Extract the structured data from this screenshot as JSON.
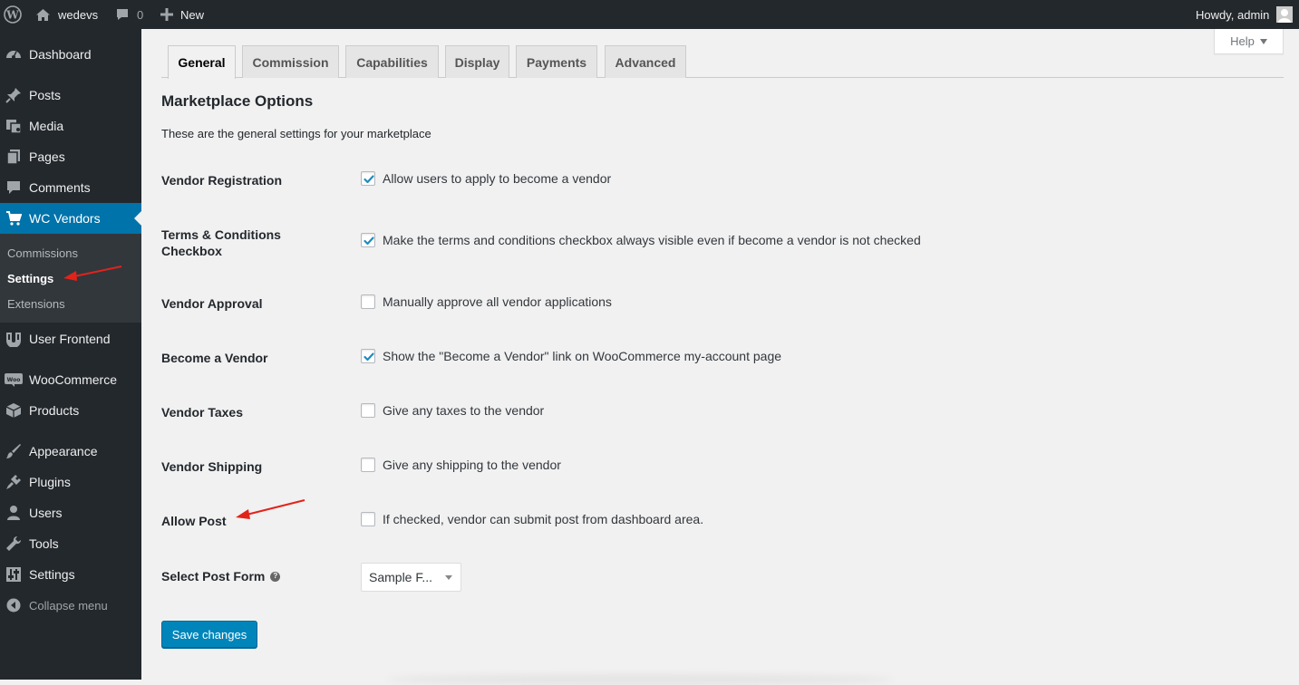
{
  "adminbar": {
    "site_name": "wedevs",
    "comments_count": "0",
    "new_label": "New",
    "greeting": "Howdy, admin"
  },
  "sidebar": {
    "items": [
      {
        "label": "Dashboard",
        "icon": "dashboard-icon"
      },
      {
        "label": "Posts",
        "icon": "pin-icon"
      },
      {
        "label": "Media",
        "icon": "media-icon"
      },
      {
        "label": "Pages",
        "icon": "pages-icon"
      },
      {
        "label": "Comments",
        "icon": "comment-icon"
      },
      {
        "label": "WC Vendors",
        "icon": "cart-icon",
        "current": true
      },
      {
        "label": "User Frontend",
        "icon": "user-frontend-icon"
      },
      {
        "label": "WooCommerce",
        "icon": "woocommerce-icon"
      },
      {
        "label": "Products",
        "icon": "box-icon"
      },
      {
        "label": "Appearance",
        "icon": "brush-icon"
      },
      {
        "label": "Plugins",
        "icon": "plug-icon"
      },
      {
        "label": "Users",
        "icon": "user-icon"
      },
      {
        "label": "Tools",
        "icon": "wrench-icon"
      },
      {
        "label": "Settings",
        "icon": "sliders-icon"
      }
    ],
    "submenu": [
      "Commissions",
      "Settings",
      "Extensions"
    ],
    "collapse_label": "Collapse menu"
  },
  "help_label": "Help",
  "tabs": [
    "General",
    "Commission",
    "Capabilities",
    "Display",
    "Payments",
    "Advanced"
  ],
  "active_tab": "General",
  "page_title": "Marketplace Options",
  "description": "These are the general settings for your marketplace",
  "settings": [
    {
      "label": "Vendor Registration",
      "text": "Allow users to apply to become a vendor",
      "checked": true
    },
    {
      "label": "Terms & Conditions Checkbox",
      "text": "Make the terms and conditions checkbox always visible even if become a vendor is not checked",
      "checked": true
    },
    {
      "label": "Vendor Approval",
      "text": "Manually approve all vendor applications",
      "checked": false
    },
    {
      "label": "Become a Vendor",
      "text": "Show the \"Become a Vendor\" link on WooCommerce my-account page",
      "checked": true
    },
    {
      "label": "Vendor Taxes",
      "text": "Give any taxes to the vendor",
      "checked": false
    },
    {
      "label": "Vendor Shipping",
      "text": "Give any shipping to the vendor",
      "checked": false
    },
    {
      "label": "Allow Post",
      "text": "If checked, vendor can submit post from dashboard area.",
      "checked": false
    }
  ],
  "post_form": {
    "label": "Select Post Form",
    "selected": "Sample F..."
  },
  "save_label": "Save changes",
  "colors": {
    "accent": "#0073aa",
    "button": "#0085ba",
    "annotation": "#e2231a",
    "sidebar": "#23282d"
  }
}
